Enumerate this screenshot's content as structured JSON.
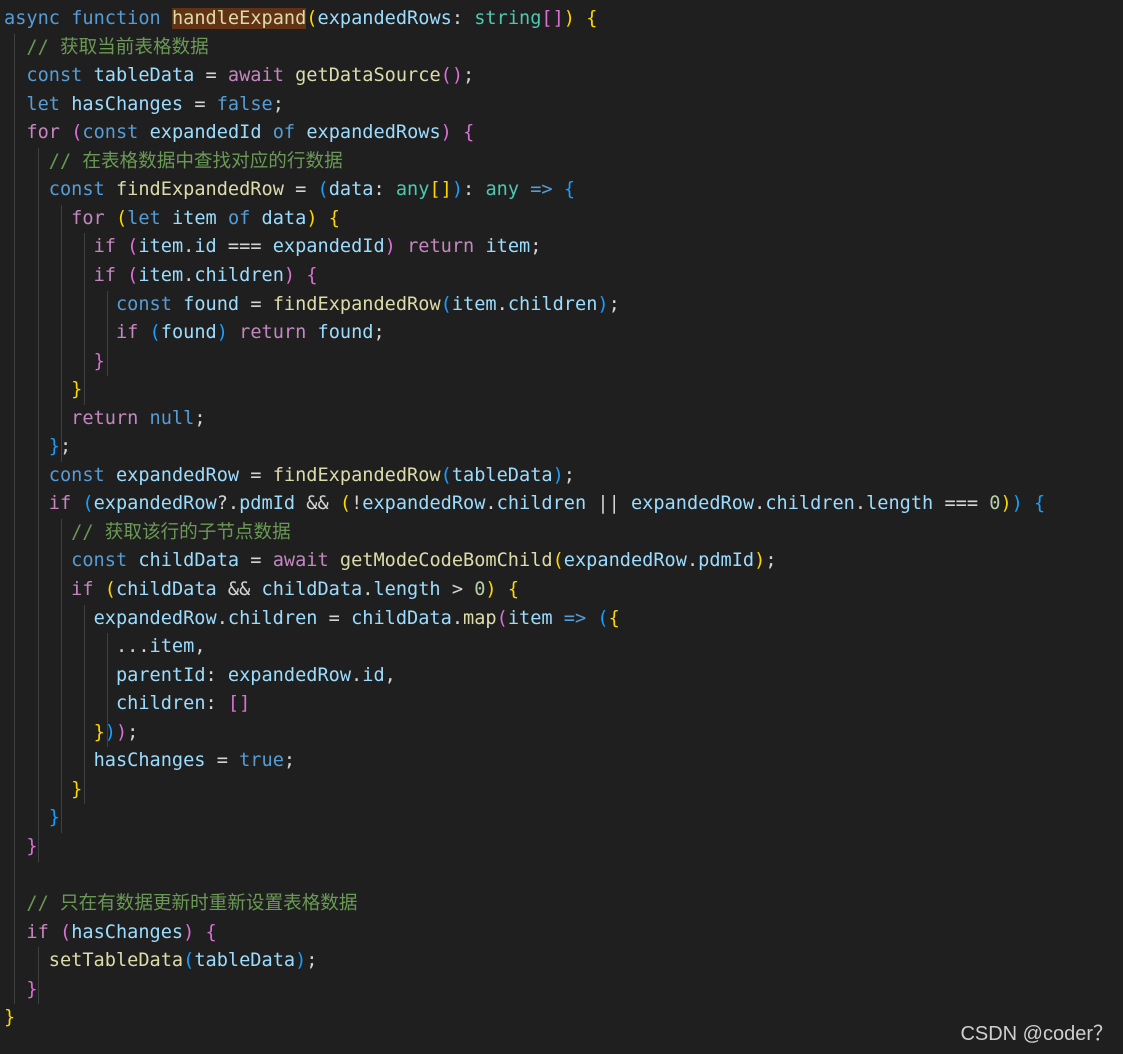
{
  "colors": {
    "background": "#1f1f1f",
    "keyword": "#569cd6",
    "control": "#c586c0",
    "function": "#dcdcaa",
    "variable": "#9cdcfe",
    "type": "#4ec9b0",
    "comment": "#6a9955",
    "number": "#b5cea8",
    "text": "#d4d4d4",
    "bracket1": "#ffd700",
    "bracket2": "#da70d6",
    "bracket3": "#179fff",
    "highlight": "#613214",
    "indent_guide": "#404040"
  },
  "code_lines": [
    [
      [
        "kw",
        "async"
      ],
      [
        "pl",
        " "
      ],
      [
        "kw",
        "function"
      ],
      [
        "pl",
        " "
      ],
      [
        "fnh",
        "handleExpand"
      ],
      [
        "b1",
        "("
      ],
      [
        "vr",
        "expandedRows"
      ],
      [
        "pl",
        ": "
      ],
      [
        "ty",
        "string"
      ],
      [
        "b2",
        "[]"
      ],
      [
        "b1",
        ")"
      ],
      [
        "pl",
        " "
      ],
      [
        "b1",
        "{"
      ]
    ],
    [
      [
        "pl",
        "  "
      ],
      [
        "cm",
        "// 获取当前表格数据"
      ]
    ],
    [
      [
        "pl",
        "  "
      ],
      [
        "kw",
        "const"
      ],
      [
        "pl",
        " "
      ],
      [
        "vr",
        "tableData"
      ],
      [
        "pl",
        " = "
      ],
      [
        "ct",
        "await"
      ],
      [
        "pl",
        " "
      ],
      [
        "fn",
        "getDataSource"
      ],
      [
        "b2",
        "()"
      ],
      [
        "pl",
        ";"
      ]
    ],
    [
      [
        "pl",
        "  "
      ],
      [
        "kw",
        "let"
      ],
      [
        "pl",
        " "
      ],
      [
        "vr",
        "hasChanges"
      ],
      [
        "pl",
        " = "
      ],
      [
        "kw",
        "false"
      ],
      [
        "pl",
        ";"
      ]
    ],
    [
      [
        "pl",
        "  "
      ],
      [
        "ct",
        "for"
      ],
      [
        "pl",
        " "
      ],
      [
        "b2",
        "("
      ],
      [
        "kw",
        "const"
      ],
      [
        "pl",
        " "
      ],
      [
        "vr",
        "expandedId"
      ],
      [
        "pl",
        " "
      ],
      [
        "kw",
        "of"
      ],
      [
        "pl",
        " "
      ],
      [
        "vr",
        "expandedRows"
      ],
      [
        "b2",
        ")"
      ],
      [
        "pl",
        " "
      ],
      [
        "b2",
        "{"
      ]
    ],
    [
      [
        "pl",
        "    "
      ],
      [
        "cm",
        "// 在表格数据中查找对应的行数据"
      ]
    ],
    [
      [
        "pl",
        "    "
      ],
      [
        "kw",
        "const"
      ],
      [
        "pl",
        " "
      ],
      [
        "fn",
        "findExpandedRow"
      ],
      [
        "pl",
        " = "
      ],
      [
        "b3",
        "("
      ],
      [
        "vr",
        "data"
      ],
      [
        "pl",
        ": "
      ],
      [
        "ty",
        "any"
      ],
      [
        "b1",
        "[]"
      ],
      [
        "b3",
        ")"
      ],
      [
        "pl",
        ": "
      ],
      [
        "ty",
        "any"
      ],
      [
        "pl",
        " "
      ],
      [
        "kw",
        "=>"
      ],
      [
        "pl",
        " "
      ],
      [
        "b3",
        "{"
      ]
    ],
    [
      [
        "pl",
        "      "
      ],
      [
        "ct",
        "for"
      ],
      [
        "pl",
        " "
      ],
      [
        "b1",
        "("
      ],
      [
        "kw",
        "let"
      ],
      [
        "pl",
        " "
      ],
      [
        "vr",
        "item"
      ],
      [
        "pl",
        " "
      ],
      [
        "kw",
        "of"
      ],
      [
        "pl",
        " "
      ],
      [
        "vr",
        "data"
      ],
      [
        "b1",
        ")"
      ],
      [
        "pl",
        " "
      ],
      [
        "b1",
        "{"
      ]
    ],
    [
      [
        "pl",
        "        "
      ],
      [
        "ct",
        "if"
      ],
      [
        "pl",
        " "
      ],
      [
        "b2",
        "("
      ],
      [
        "vr",
        "item"
      ],
      [
        "pl",
        "."
      ],
      [
        "vr",
        "id"
      ],
      [
        "pl",
        " === "
      ],
      [
        "vr",
        "expandedId"
      ],
      [
        "b2",
        ")"
      ],
      [
        "pl",
        " "
      ],
      [
        "ct",
        "return"
      ],
      [
        "pl",
        " "
      ],
      [
        "vr",
        "item"
      ],
      [
        "pl",
        ";"
      ]
    ],
    [
      [
        "pl",
        "        "
      ],
      [
        "ct",
        "if"
      ],
      [
        "pl",
        " "
      ],
      [
        "b2",
        "("
      ],
      [
        "vr",
        "item"
      ],
      [
        "pl",
        "."
      ],
      [
        "vr",
        "children"
      ],
      [
        "b2",
        ")"
      ],
      [
        "pl",
        " "
      ],
      [
        "b2",
        "{"
      ]
    ],
    [
      [
        "pl",
        "          "
      ],
      [
        "kw",
        "const"
      ],
      [
        "pl",
        " "
      ],
      [
        "vr",
        "found"
      ],
      [
        "pl",
        " = "
      ],
      [
        "fn",
        "findExpandedRow"
      ],
      [
        "b3",
        "("
      ],
      [
        "vr",
        "item"
      ],
      [
        "pl",
        "."
      ],
      [
        "vr",
        "children"
      ],
      [
        "b3",
        ")"
      ],
      [
        "pl",
        ";"
      ]
    ],
    [
      [
        "pl",
        "          "
      ],
      [
        "ct",
        "if"
      ],
      [
        "pl",
        " "
      ],
      [
        "b3",
        "("
      ],
      [
        "vr",
        "found"
      ],
      [
        "b3",
        ")"
      ],
      [
        "pl",
        " "
      ],
      [
        "ct",
        "return"
      ],
      [
        "pl",
        " "
      ],
      [
        "vr",
        "found"
      ],
      [
        "pl",
        ";"
      ]
    ],
    [
      [
        "pl",
        "        "
      ],
      [
        "b2",
        "}"
      ]
    ],
    [
      [
        "pl",
        "      "
      ],
      [
        "b1",
        "}"
      ]
    ],
    [
      [
        "pl",
        "      "
      ],
      [
        "ct",
        "return"
      ],
      [
        "pl",
        " "
      ],
      [
        "kw",
        "null"
      ],
      [
        "pl",
        ";"
      ]
    ],
    [
      [
        "pl",
        "    "
      ],
      [
        "b3",
        "}"
      ],
      [
        "pl",
        ";"
      ]
    ],
    [
      [
        "pl",
        "    "
      ],
      [
        "kw",
        "const"
      ],
      [
        "pl",
        " "
      ],
      [
        "vr",
        "expandedRow"
      ],
      [
        "pl",
        " = "
      ],
      [
        "fn",
        "findExpandedRow"
      ],
      [
        "b3",
        "("
      ],
      [
        "vr",
        "tableData"
      ],
      [
        "b3",
        ")"
      ],
      [
        "pl",
        ";"
      ]
    ],
    [
      [
        "pl",
        "    "
      ],
      [
        "ct",
        "if"
      ],
      [
        "pl",
        " "
      ],
      [
        "b3",
        "("
      ],
      [
        "vr",
        "expandedRow"
      ],
      [
        "pl",
        "?."
      ],
      [
        "vr",
        "pdmId"
      ],
      [
        "pl",
        " && "
      ],
      [
        "b1",
        "("
      ],
      [
        "pl",
        "!"
      ],
      [
        "vr",
        "expandedRow"
      ],
      [
        "pl",
        "."
      ],
      [
        "vr",
        "children"
      ],
      [
        "pl",
        " || "
      ],
      [
        "vr",
        "expandedRow"
      ],
      [
        "pl",
        "."
      ],
      [
        "vr",
        "children"
      ],
      [
        "pl",
        "."
      ],
      [
        "vr",
        "length"
      ],
      [
        "pl",
        " === "
      ],
      [
        "nm",
        "0"
      ],
      [
        "b1",
        ")"
      ],
      [
        "b3",
        ")"
      ],
      [
        "pl",
        " "
      ],
      [
        "b3",
        "{"
      ]
    ],
    [
      [
        "pl",
        "      "
      ],
      [
        "cm",
        "// 获取该行的子节点数据"
      ]
    ],
    [
      [
        "pl",
        "      "
      ],
      [
        "kw",
        "const"
      ],
      [
        "pl",
        " "
      ],
      [
        "vr",
        "childData"
      ],
      [
        "pl",
        " = "
      ],
      [
        "ct",
        "await"
      ],
      [
        "pl",
        " "
      ],
      [
        "fn",
        "getModeCodeBomChild"
      ],
      [
        "b1",
        "("
      ],
      [
        "vr",
        "expandedRow"
      ],
      [
        "pl",
        "."
      ],
      [
        "vr",
        "pdmId"
      ],
      [
        "b1",
        ")"
      ],
      [
        "pl",
        ";"
      ]
    ],
    [
      [
        "pl",
        "      "
      ],
      [
        "ct",
        "if"
      ],
      [
        "pl",
        " "
      ],
      [
        "b1",
        "("
      ],
      [
        "vr",
        "childData"
      ],
      [
        "pl",
        " && "
      ],
      [
        "vr",
        "childData"
      ],
      [
        "pl",
        "."
      ],
      [
        "vr",
        "length"
      ],
      [
        "pl",
        " > "
      ],
      [
        "nm",
        "0"
      ],
      [
        "b1",
        ")"
      ],
      [
        "pl",
        " "
      ],
      [
        "b1",
        "{"
      ]
    ],
    [
      [
        "pl",
        "        "
      ],
      [
        "vr",
        "expandedRow"
      ],
      [
        "pl",
        "."
      ],
      [
        "vr",
        "children"
      ],
      [
        "pl",
        " = "
      ],
      [
        "vr",
        "childData"
      ],
      [
        "pl",
        "."
      ],
      [
        "fn",
        "map"
      ],
      [
        "b2",
        "("
      ],
      [
        "vr",
        "item"
      ],
      [
        "pl",
        " "
      ],
      [
        "kw",
        "=>"
      ],
      [
        "pl",
        " "
      ],
      [
        "b3",
        "("
      ],
      [
        "b1",
        "{"
      ]
    ],
    [
      [
        "pl",
        "          ..."
      ],
      [
        "vr",
        "item"
      ],
      [
        "pl",
        ","
      ]
    ],
    [
      [
        "pl",
        "          "
      ],
      [
        "vr",
        "parentId"
      ],
      [
        "pl",
        ": "
      ],
      [
        "vr",
        "expandedRow"
      ],
      [
        "pl",
        "."
      ],
      [
        "vr",
        "id"
      ],
      [
        "pl",
        ","
      ]
    ],
    [
      [
        "pl",
        "          "
      ],
      [
        "vr",
        "children"
      ],
      [
        "pl",
        ": "
      ],
      [
        "b2",
        "[]"
      ]
    ],
    [
      [
        "pl",
        "        "
      ],
      [
        "b1",
        "}"
      ],
      [
        "b3",
        ")"
      ],
      [
        "b2",
        ")"
      ],
      [
        "pl",
        ";"
      ]
    ],
    [
      [
        "pl",
        "        "
      ],
      [
        "vr",
        "hasChanges"
      ],
      [
        "pl",
        " = "
      ],
      [
        "kw",
        "true"
      ],
      [
        "pl",
        ";"
      ]
    ],
    [
      [
        "pl",
        "      "
      ],
      [
        "b1",
        "}"
      ]
    ],
    [
      [
        "pl",
        "    "
      ],
      [
        "b3",
        "}"
      ]
    ],
    [
      [
        "pl",
        "  "
      ],
      [
        "b2",
        "}"
      ]
    ],
    [
      [
        "pl",
        ""
      ]
    ],
    [
      [
        "pl",
        "  "
      ],
      [
        "cm",
        "// 只在有数据更新时重新设置表格数据"
      ]
    ],
    [
      [
        "pl",
        "  "
      ],
      [
        "ct",
        "if"
      ],
      [
        "pl",
        " "
      ],
      [
        "b2",
        "("
      ],
      [
        "vr",
        "hasChanges"
      ],
      [
        "b2",
        ")"
      ],
      [
        "pl",
        " "
      ],
      [
        "b2",
        "{"
      ]
    ],
    [
      [
        "pl",
        "    "
      ],
      [
        "fn",
        "setTableData"
      ],
      [
        "b3",
        "("
      ],
      [
        "vr",
        "tableData"
      ],
      [
        "b3",
        ")"
      ],
      [
        "pl",
        ";"
      ]
    ],
    [
      [
        "pl",
        "  "
      ],
      [
        "b2",
        "}"
      ]
    ],
    [
      [
        "b1",
        "}"
      ]
    ]
  ],
  "watermark": "CSDN @coder？"
}
